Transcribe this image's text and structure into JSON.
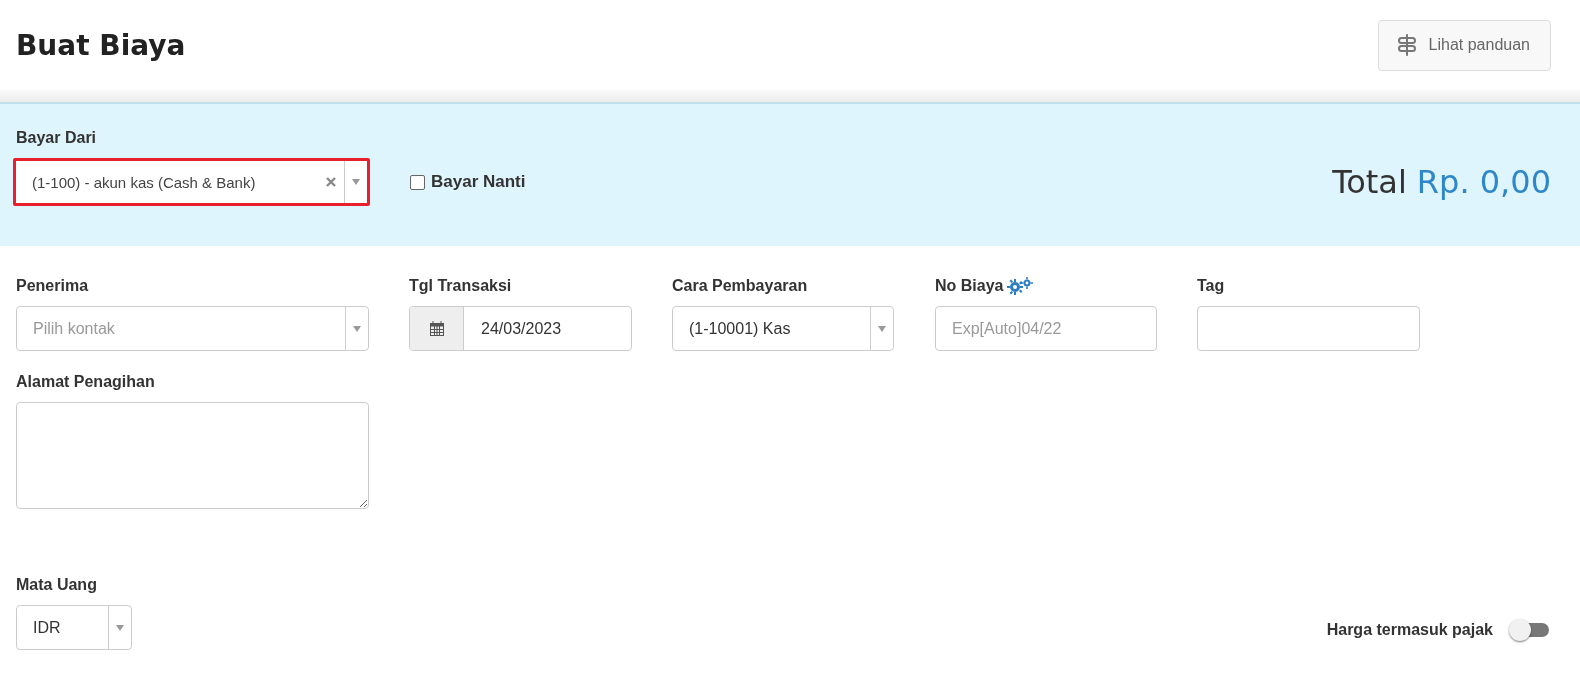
{
  "header": {
    "title": "Buat Biaya",
    "guide_button": "Lihat panduan"
  },
  "pay_from": {
    "label": "Bayar Dari",
    "value": "(1-100) - akun kas (Cash & Bank)",
    "highlighted": true
  },
  "pay_later": {
    "label": "Bayar Nanti",
    "checked": false
  },
  "total": {
    "label": "Total",
    "amount": "Rp. 0,00"
  },
  "fields": [
    {
      "kind": "select",
      "label": "Penerima",
      "placeholder": "Pilih kontak"
    },
    {
      "kind": "date",
      "label": "Tgl Transaksi",
      "value": "24/03/2023"
    },
    {
      "kind": "select",
      "label": "Cara Pembayaran",
      "value": "(1-10001) Kas"
    },
    {
      "kind": "text",
      "label": "No Biaya",
      "placeholder": "Exp[Auto]04/22",
      "settings": true
    },
    {
      "kind": "text",
      "label": "Tag"
    }
  ],
  "billing_address": {
    "label": "Alamat Penagihan"
  },
  "currency": {
    "label": "Mata Uang",
    "value": "IDR"
  },
  "tax_inclusive": {
    "label": "Harga termasuk pajak",
    "on": false
  }
}
